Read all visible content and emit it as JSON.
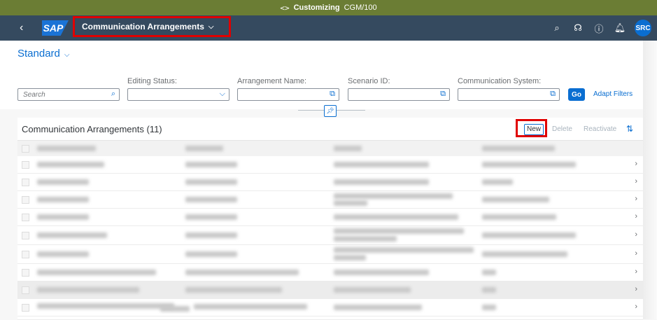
{
  "top_strip": {
    "code_icon": "code-brackets-icon",
    "title": "Customizing",
    "system": "CGM/100"
  },
  "shell": {
    "back_icon": "back-icon",
    "logo_text": "SAP",
    "app_title": "Communication Arrangements",
    "icons": [
      "search-icon",
      "headset-icon",
      "help-icon",
      "notifications-icon"
    ],
    "avatar": "SRC"
  },
  "filter_bar": {
    "variant": "Standard",
    "search_placeholder": "Search",
    "labels": {
      "editing_status": "Editing Status:",
      "arrangement_name": "Arrangement Name:",
      "scenario_id": "Scenario ID:",
      "communication_system": "Communication System:"
    },
    "go": "Go",
    "adapt_filters": "Adapt Filters"
  },
  "table": {
    "title": "Communication Arrangements (11)",
    "buttons": {
      "new": "New",
      "delete": "Delete",
      "reactivate": "Reactivate"
    },
    "row_count_visible": 10
  },
  "colors": {
    "accent": "#0a6ed1",
    "shell": "#354a5f",
    "top_strip": "#6b7d34",
    "highlight": "#e00000"
  }
}
